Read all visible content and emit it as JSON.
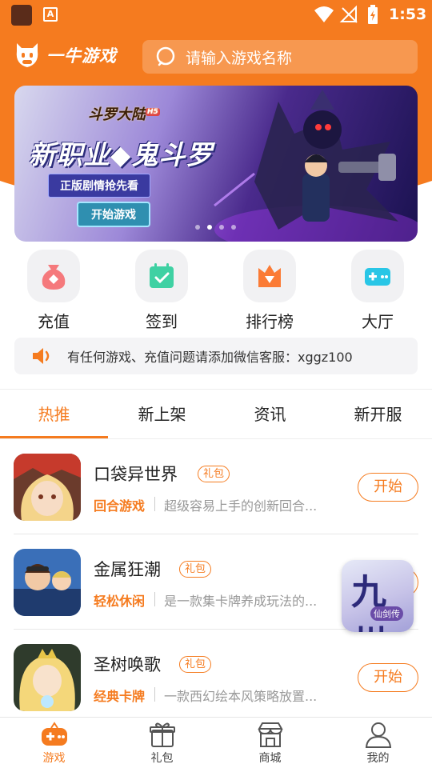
{
  "status_bar": {
    "time": "1:53",
    "a_icon_text": "A"
  },
  "header": {
    "logo_text": "一牛游戏",
    "search_placeholder": "请输入游戏名称"
  },
  "banner": {
    "logo_text": "斗罗大陆",
    "logo_badge": "H5",
    "headline": "新职业◆鬼斗罗",
    "subtitle": "正版剧情抢先看",
    "button": "开始游戏",
    "dots": 4,
    "active_dot": 1
  },
  "quick_entries": [
    {
      "label": "充值",
      "icon": "money-bag-icon"
    },
    {
      "label": "签到",
      "icon": "calendar-check-icon"
    },
    {
      "label": "排行榜",
      "icon": "ranking-diamond-icon"
    },
    {
      "label": "大厅",
      "icon": "gamepad-icon"
    }
  ],
  "notice": {
    "text": "有任何游戏、充值问题请添加微信客服：xggz100"
  },
  "tabs": [
    {
      "label": "热推",
      "active": true
    },
    {
      "label": "新上架",
      "active": false
    },
    {
      "label": "资讯",
      "active": false
    },
    {
      "label": "新开服",
      "active": false
    }
  ],
  "games": [
    {
      "name": "口袋异世界",
      "gift": "礼包",
      "category": "回合游戏",
      "desc": "超级容易上手的创新回合...",
      "action": "开始"
    },
    {
      "name": "金属狂潮",
      "gift": "礼包",
      "category": "轻松休闲",
      "desc": "是一款集卡牌养成玩法的...",
      "action": "开始"
    },
    {
      "name": "圣树唤歌",
      "gift": "礼包",
      "category": "经典卡牌",
      "desc": "一款西幻绘本风策略放置...",
      "action": "开始"
    }
  ],
  "floating_ad": {
    "title": "九州",
    "subtitle": "仙剑传"
  },
  "bottom_nav": [
    {
      "label": "游戏",
      "icon": "gamepad-icon",
      "active": true
    },
    {
      "label": "礼包",
      "icon": "gift-icon",
      "active": false
    },
    {
      "label": "商城",
      "icon": "store-icon",
      "active": false
    },
    {
      "label": "我的",
      "icon": "user-icon",
      "active": false
    }
  ],
  "colors": {
    "accent": "#f57b1f",
    "text": "#222222",
    "muted": "#999999"
  }
}
